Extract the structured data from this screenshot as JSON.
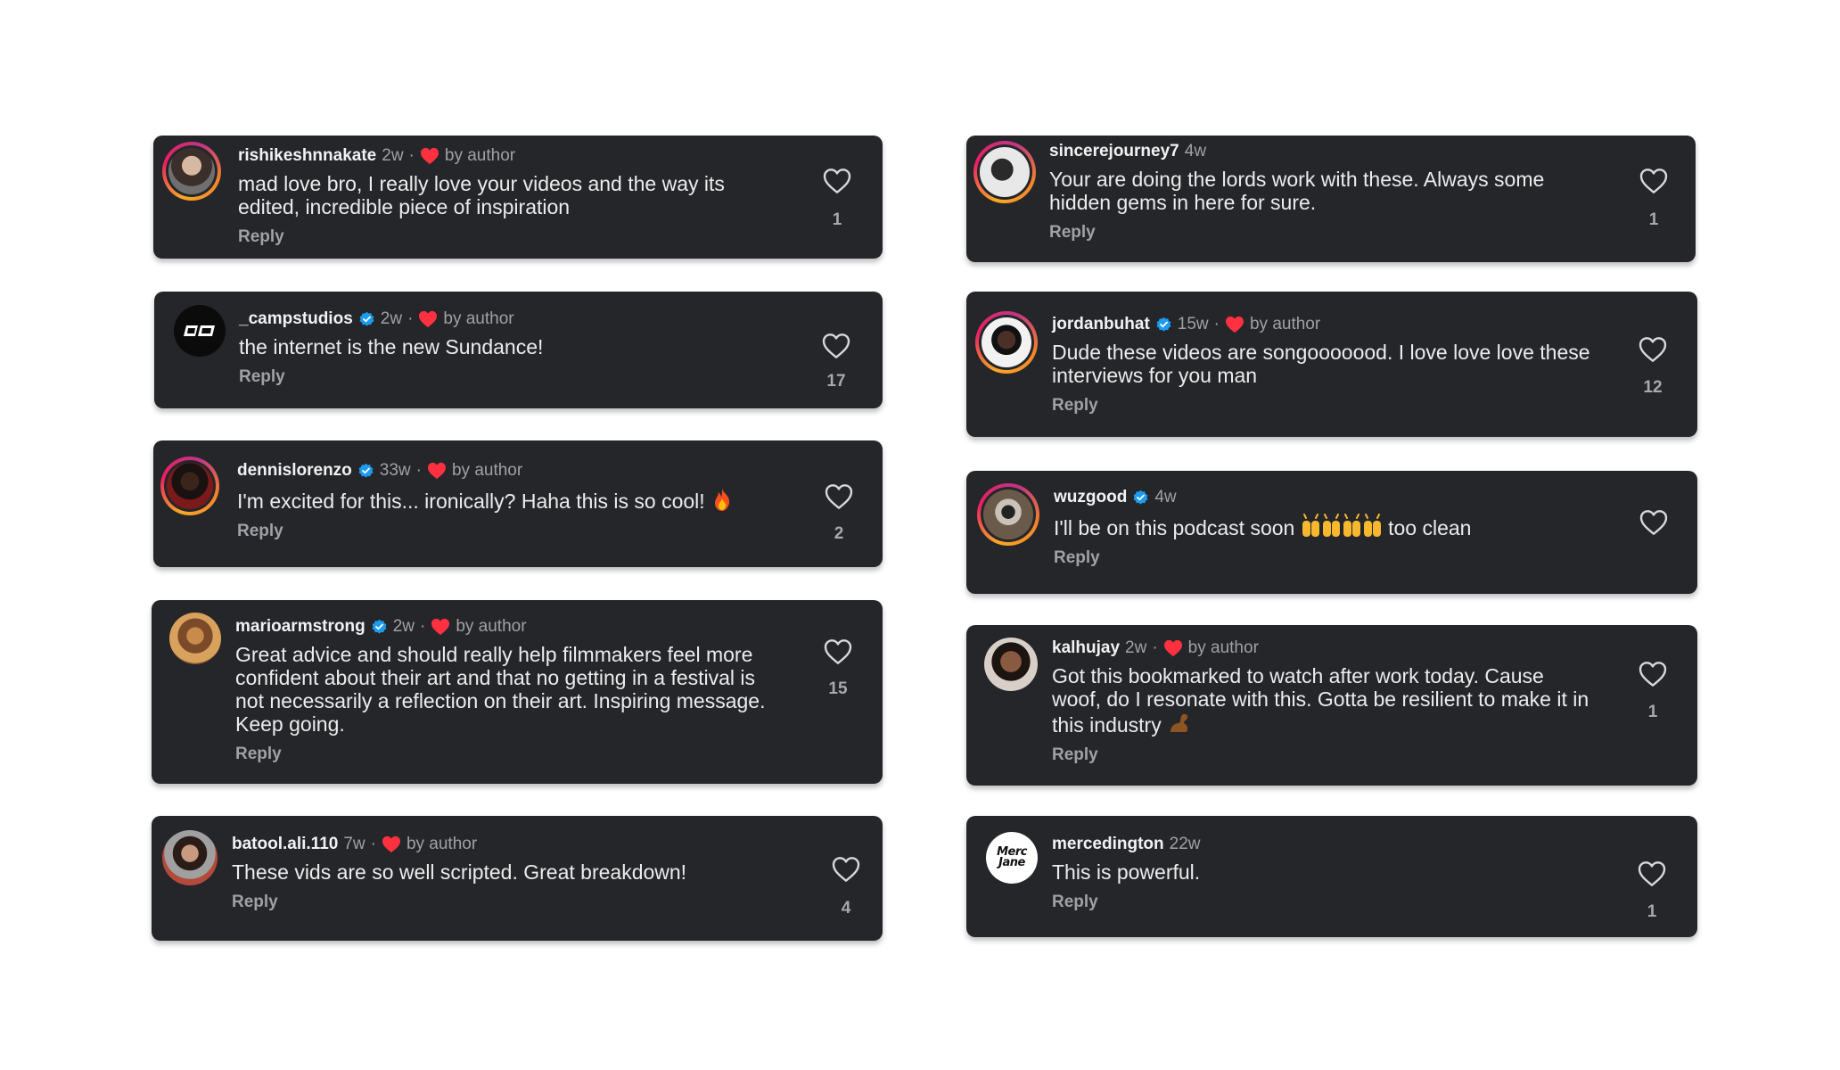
{
  "colors": {
    "card_bg": "#25262a",
    "verified_blue": "#1d9bf0",
    "heart_red": "#ff3040"
  },
  "separator": "·",
  "reply_label": "Reply",
  "by_author_label": "by author",
  "comments": [
    {
      "username": "rishikeshnnakate",
      "time": "2w",
      "verified": false,
      "liked_by_author": true,
      "text": "mad love bro, I really love your videos and the way its edited, incredible piece of inspiration",
      "likes": "1"
    },
    {
      "username": "_campstudios",
      "time": "2w",
      "verified": true,
      "liked_by_author": true,
      "text": "the internet is the new Sundance!",
      "likes": "17"
    },
    {
      "username": "dennislorenzo",
      "time": "33w",
      "verified": true,
      "liked_by_author": true,
      "text": "I'm excited for this... ironically? Haha this is so cool!",
      "emoji": "fire-emoji",
      "likes": "2"
    },
    {
      "username": "marioarmstrong",
      "time": "2w",
      "verified": true,
      "liked_by_author": true,
      "text": "Great advice and should really help filmmakers feel more confident about their art and that no getting in a festival is not necessarily a reflection on their art. Inspiring message. Keep going.",
      "likes": "15"
    },
    {
      "username": "batool.ali.110",
      "time": "7w",
      "verified": false,
      "liked_by_author": true,
      "text": "These vids are so well scripted. Great breakdown!",
      "likes": "4"
    },
    {
      "username": "sincerejourney7",
      "time": "4w",
      "verified": false,
      "liked_by_author": false,
      "text": "Your are doing the lords work with these. Always some hidden gems in here for sure.",
      "likes": "1"
    },
    {
      "username": "jordanbuhat",
      "time": "15w",
      "verified": true,
      "liked_by_author": true,
      "text": "Dude these videos are songooooood. I love love love these interviews for you man",
      "likes": "12"
    },
    {
      "username": "wuzgood",
      "time": "4w",
      "verified": true,
      "liked_by_author": false,
      "text_before": "I'll be on this podcast soon",
      "emoji": "raising-hands-emoji",
      "text_after": "too clean",
      "likes": ""
    },
    {
      "username": "kalhujay",
      "time": "2w",
      "verified": false,
      "liked_by_author": true,
      "text": "Got this bookmarked to watch after work today. Cause woof, do I resonate with this. Gotta be resilient to make it in this industry",
      "emoji": "flexed-biceps-emoji",
      "likes": "1"
    },
    {
      "username": "mercedington",
      "time": "22w",
      "verified": false,
      "liked_by_author": false,
      "text": "This is powerful.",
      "likes": "1",
      "avatar_text": "Merc Jane"
    }
  ]
}
